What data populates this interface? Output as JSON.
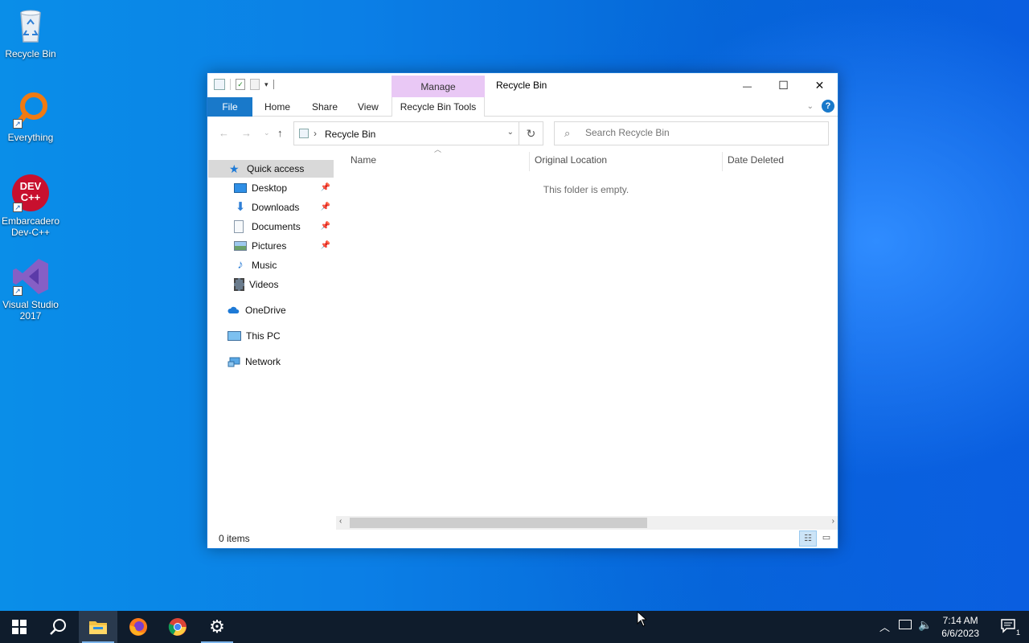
{
  "desktop": {
    "icons": [
      {
        "label": "Recycle Bin",
        "icon": "recycle-bin-icon"
      },
      {
        "label": "Everything",
        "icon": "everything-search-icon"
      },
      {
        "label": "Embarcadero Dev-C++",
        "icon": "devcpp-icon",
        "logo_text": "DEV C++"
      },
      {
        "label": "Visual Studio 2017",
        "icon": "visual-studio-icon"
      }
    ]
  },
  "window": {
    "title": "Recycle Bin",
    "contextual_tab_group": "Manage",
    "ribbon_tabs": [
      "File",
      "Home",
      "Share",
      "View",
      "Recycle Bin Tools"
    ],
    "controls": {
      "minimize": "—",
      "maximize": "☐",
      "close": "✕"
    },
    "help": "?"
  },
  "address": {
    "breadcrumb": "Recycle Bin",
    "search_placeholder": "Search Recycle Bin"
  },
  "nav": {
    "quick_access": "Quick access",
    "pinned": [
      {
        "label": "Desktop",
        "icon": "desktop-folder-icon",
        "pinned": true
      },
      {
        "label": "Downloads",
        "icon": "downloads-icon",
        "pinned": true
      },
      {
        "label": "Documents",
        "icon": "documents-icon",
        "pinned": true
      },
      {
        "label": "Pictures",
        "icon": "pictures-icon",
        "pinned": true
      },
      {
        "label": "Music",
        "icon": "music-icon",
        "pinned": false
      },
      {
        "label": "Videos",
        "icon": "videos-icon",
        "pinned": false
      }
    ],
    "onedrive": "OneDrive",
    "this_pc": "This PC",
    "network": "Network"
  },
  "content": {
    "columns": [
      "Name",
      "Original Location",
      "Date Deleted"
    ],
    "empty_message": "This folder is empty."
  },
  "status": {
    "item_count": "0 items"
  },
  "taskbar": {
    "apps": [
      "start-icon",
      "search-icon",
      "file-explorer-icon",
      "firefox-icon",
      "chrome-icon",
      "settings-icon"
    ],
    "time": "7:14 AM",
    "date": "6/6/2023",
    "notification_count": "1"
  },
  "colors": {
    "accent": "#1979ca",
    "manage_tab": "#e9c8f5",
    "taskbar": "#0f1c2c"
  }
}
